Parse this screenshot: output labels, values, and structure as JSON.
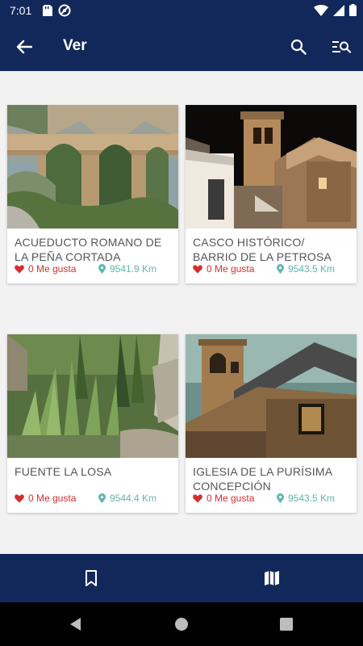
{
  "status_bar": {
    "time": "7:01",
    "icons_left": [
      "sd-card-icon",
      "do-not-disturb-icon"
    ],
    "icons_right": [
      "wifi-icon",
      "signal-icon",
      "battery-icon"
    ]
  },
  "app_bar": {
    "title": "Ver",
    "back_icon": "arrow-back-icon",
    "search_icon": "search-icon",
    "filter_icon": "filter-list-search-icon",
    "background": "#13285a"
  },
  "places": [
    {
      "title": "ACUEDUCTO ROMANO DE LA PEÑA CORTADA",
      "likes": "0 Me gusta",
      "distance": "9541.9 Km"
    },
    {
      "title": "CASCO HISTÓRICO/ BARRIO DE LA PETROSA",
      "likes": "0 Me gusta",
      "distance": "9543.5 Km"
    },
    {
      "title": "FUENTE LA LOSA",
      "likes": "0 Me gusta",
      "distance": "9544.4 Km"
    },
    {
      "title": "IGLESIA DE LA PURÍSIMA CONCEPCIÓN",
      "likes": "0 Me gusta",
      "distance": "9543.5 Km"
    }
  ],
  "bottom_nav": {
    "items": [
      "bookmark-icon",
      "map-icon"
    ]
  },
  "colors": {
    "primary": "#13285a",
    "like": "#d32f2f",
    "distance": "#5bb7ad",
    "background": "#f2f2f2"
  }
}
